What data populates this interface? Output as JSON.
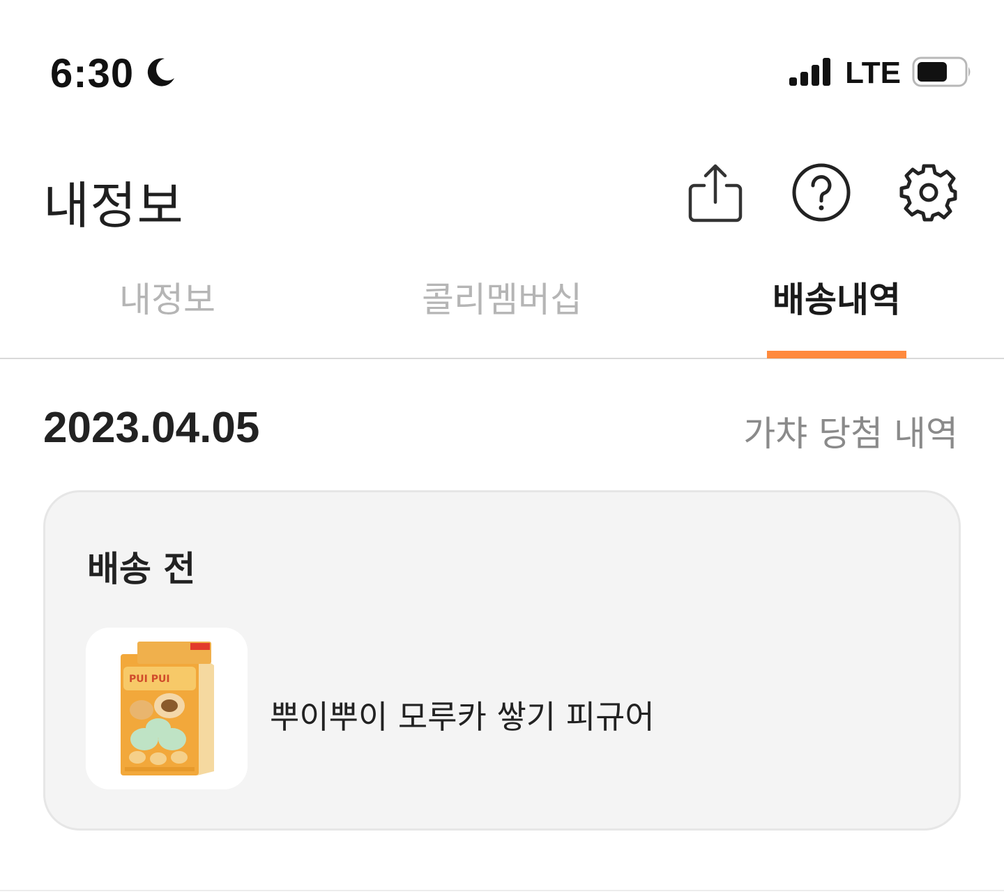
{
  "status_bar": {
    "time": "6:30",
    "moon_icon": "moon-icon",
    "network": "LTE"
  },
  "header": {
    "title": "내정보",
    "icons": [
      "share-icon",
      "help-icon",
      "settings-icon"
    ]
  },
  "tabs": [
    {
      "label": "내정보",
      "active": false
    },
    {
      "label": "콜리멤버십",
      "active": false
    },
    {
      "label": "배송내역",
      "active": true
    }
  ],
  "colors": {
    "accent": "#ff8a3d",
    "inactive_tab": "#b5b5b5",
    "card_bg": "#f4f4f4"
  },
  "delivery": {
    "date": "2023.04.05",
    "history_link": "가챠 당첨 내역",
    "card": {
      "status": "배송 전",
      "product_name": "뿌이뿌이 모루카 쌓기 피규어"
    }
  }
}
